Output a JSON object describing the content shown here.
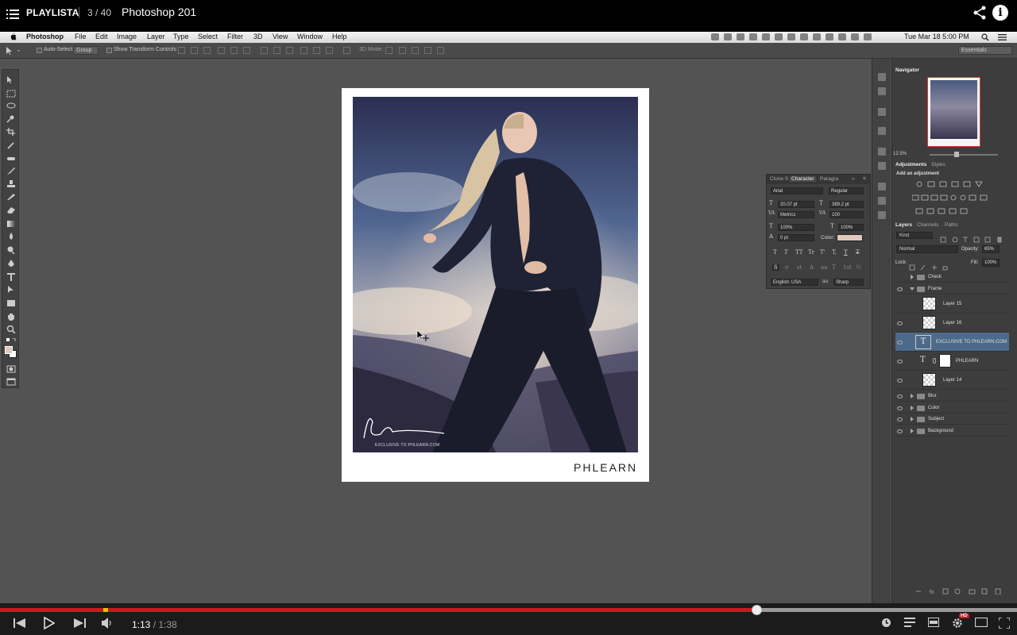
{
  "youtube": {
    "playlist_label": "PLAYLISTA",
    "playlist_position": "3 / 40",
    "video_title": "Photoshop 201",
    "current_time": "1:13",
    "duration": "/ 1:38",
    "progress_fraction": 0.744,
    "buffered_fraction": 1.0,
    "hd_badge": "HD",
    "colors": {
      "progress": "#cc181e",
      "marker": "#e8c000"
    }
  },
  "menubar": {
    "app_name": "Photoshop",
    "items": [
      "File",
      "Edit",
      "Image",
      "Layer",
      "Type",
      "Select",
      "Filter",
      "3D",
      "View",
      "Window",
      "Help"
    ],
    "clock": "Tue Mar 18  5:00 PM"
  },
  "options_bar": {
    "auto_select_label": "Auto-Select:",
    "auto_select_value": "Group",
    "transform_label": "Show Transform Controls",
    "mode_3d_label": "3D Mode:",
    "workspace": "Essentials"
  },
  "document": {
    "brand": "PHLEARN",
    "caption": "EXCLUSIVE TO PHLEARN.COM"
  },
  "character_panel": {
    "tabs": [
      "Clone S",
      "Character",
      "Paragra"
    ],
    "font_family": "Arial",
    "font_style": "Regular",
    "font_size": "20.07 pt",
    "leading": "389.2 pt",
    "kerning": "Metrics",
    "tracking": "100",
    "vertical_scale": "100%",
    "horizontal_scale": "100%",
    "baseline_shift": "0 pt",
    "color_label": "Color:",
    "color": "#e1c9bd",
    "language": "English: USA",
    "antialias": "Sharp"
  },
  "navigator": {
    "title": "Navigator",
    "zoom": "12.5%"
  },
  "adjustments": {
    "tabs": [
      "Adjustments",
      "Styles"
    ],
    "hint": "Add an adjustment"
  },
  "layers_panel": {
    "tabs": [
      "Layers",
      "Channels",
      "Paths"
    ],
    "filter_kind": "Kind",
    "blend_mode": "Normal",
    "opacity_label": "Opacity:",
    "opacity": "65%",
    "lock_label": "Lock:",
    "fill_label": "Fill:",
    "fill": "100%",
    "layers": [
      {
        "name": "Check",
        "type": "group",
        "visible": false
      },
      {
        "name": "Frame",
        "type": "group-open",
        "visible": true
      },
      {
        "name": "Layer 15",
        "type": "pixel",
        "visible": false
      },
      {
        "name": "Layer 16",
        "type": "pixel",
        "visible": true
      },
      {
        "name": "EXCLUSIVE TO PHLEARN.COM",
        "type": "text",
        "visible": true,
        "selected": true
      },
      {
        "name": "PHLEARN",
        "type": "text-masked",
        "visible": true
      },
      {
        "name": "Layer 14",
        "type": "pixel",
        "visible": true
      },
      {
        "name": "Blur",
        "type": "group",
        "visible": true
      },
      {
        "name": "Color",
        "type": "group",
        "visible": true
      },
      {
        "name": "Subject",
        "type": "group",
        "visible": true
      },
      {
        "name": "Background",
        "type": "group",
        "visible": true
      }
    ]
  }
}
